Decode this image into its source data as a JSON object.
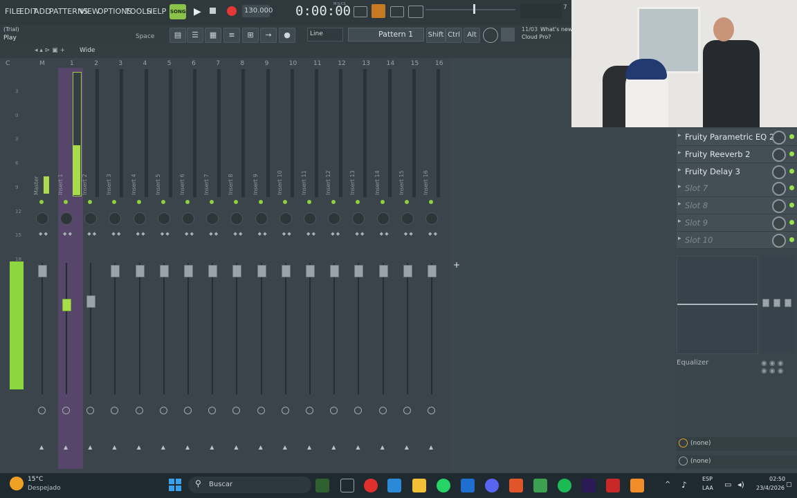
{
  "menu": [
    "FILE",
    "EDIT",
    "ADD",
    "PATTERNS",
    "VIEW",
    "OPTIONS",
    "TOOLS",
    "HELP"
  ],
  "transport": {
    "mode": "SONG",
    "tempo": "130.000",
    "time": "0:00:00",
    "time_unit": "M:S:CS"
  },
  "hint": {
    "line1": "(Trial)",
    "line2": "Play",
    "shortcut": "Space"
  },
  "toolbar2": {
    "snap": "Line",
    "pattern": "Pattern 1",
    "shift": "Shift",
    "ctrl": "Ctrl",
    "alt": "Alt",
    "news_date": "11/03",
    "news_text": "What's new",
    "news_sub": "Cloud Pro?"
  },
  "cpu_num": "7",
  "mixer": {
    "view_label": "Wide",
    "top_labels": [
      "C",
      "M"
    ],
    "channel_numbers": [
      "1",
      "2",
      "3",
      "4",
      "5",
      "6",
      "7",
      "8",
      "9",
      "10",
      "11",
      "12",
      "13",
      "14",
      "15",
      "16"
    ],
    "channels": [
      "Master",
      "Insert 1",
      "Insert 2",
      "Insert 3",
      "Insert 4",
      "Insert 5",
      "Insert 6",
      "Insert 7",
      "Insert 8",
      "Insert 9",
      "Insert 10",
      "Insert 11",
      "Insert 12",
      "Insert 13",
      "Insert 14",
      "Insert 15",
      "Insert 16"
    ],
    "scale": [
      "3",
      "0",
      "3",
      "6",
      "9",
      "12",
      "15",
      "18"
    ]
  },
  "effects": [
    {
      "label": "Fruity Parametric EQ 2",
      "active": true
    },
    {
      "label": "Fruity Reeverb 2",
      "active": true
    },
    {
      "label": "Fruity Delay 3",
      "active": true
    },
    {
      "label": "Slot 7",
      "active": false
    },
    {
      "label": "Slot 8",
      "active": false
    },
    {
      "label": "Slot 9",
      "active": false
    },
    {
      "label": "Slot 10",
      "active": false
    }
  ],
  "eq_label": "Equalizer",
  "routing": [
    "(none)",
    "(none)"
  ],
  "taskbar": {
    "temp": "15°C",
    "weather": "Despejado",
    "search": "Buscar",
    "lang1": "ESP",
    "lang2": "LAA",
    "time": "02:50",
    "date": "23/4/2026"
  },
  "colors": {
    "accent_green": "#9be04d",
    "record": "#e53935",
    "selected_channel": "#5a4a6e"
  }
}
